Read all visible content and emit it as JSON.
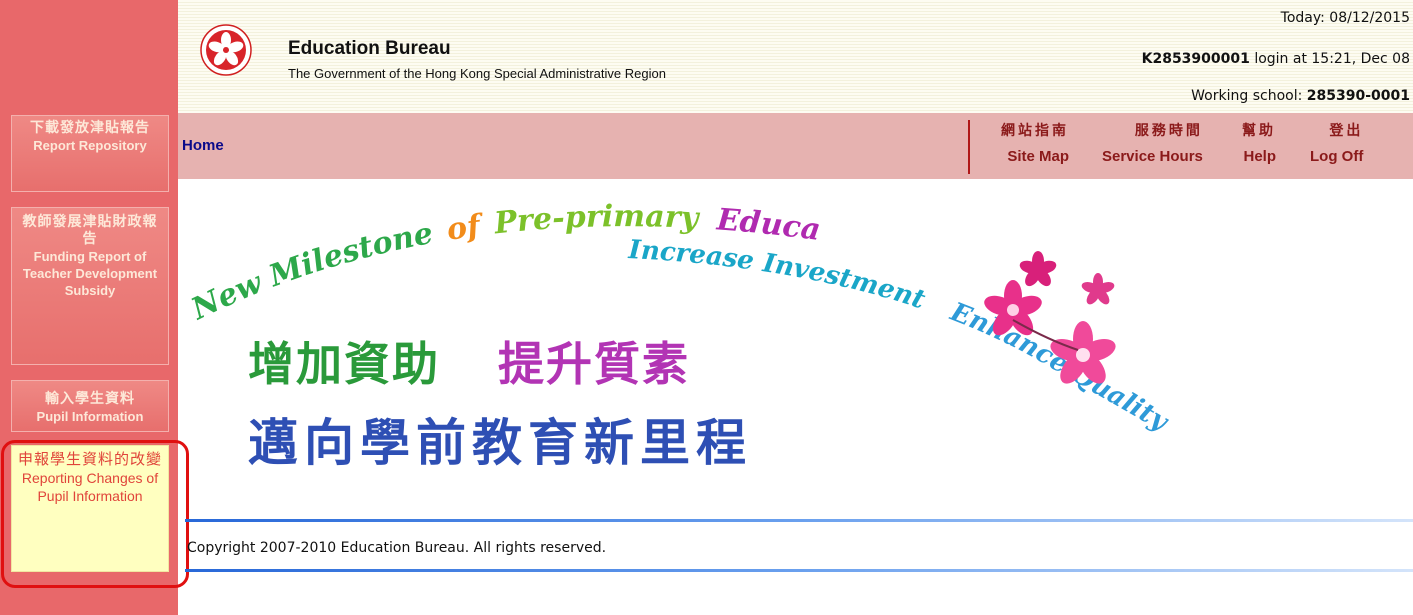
{
  "sidebar": {
    "items": [
      {
        "zh": "下載發放津貼報告",
        "en": "Report Repository"
      },
      {
        "zh": "教師發展津貼財政報告",
        "en": "Funding Report of Teacher Development Subsidy"
      },
      {
        "zh": "輸入學生資料",
        "en": "Pupil Information"
      },
      {
        "zh": "申報學生資料的改變",
        "en": "Reporting Changes of Pupil Information",
        "active": true
      }
    ]
  },
  "header": {
    "org_name": "Education Bureau",
    "org_sub": "The Government of the Hong Kong Special Administrative Region",
    "today_label": "Today: ",
    "today_value": "08/12/2015",
    "login_user": "K2853900001",
    "login_text": " login at 15:21, Dec 08",
    "school_label": "Working school: ",
    "school_value": "285390-0001"
  },
  "nav": {
    "home": "Home",
    "items": [
      {
        "zh": "網站指南",
        "en": "Site Map"
      },
      {
        "zh": "服務時間",
        "en": "Service Hours"
      },
      {
        "zh": "幫助",
        "en": "Help"
      },
      {
        "zh": "登出",
        "en": "Log Off"
      }
    ]
  },
  "banner": {
    "line_a1": "New Milestone",
    "line_a2": "of",
    "line_a3": "Pre-primary",
    "line_a4": "Education",
    "line_b": "Increase Investment",
    "line_c": "Enhance Quality",
    "zh_line1_part1": "增加資助",
    "zh_line1_part2": "提升質素",
    "zh_line2": "邁向學前教育新里程"
  },
  "footer": {
    "copyright": "Copyright 2007-2010 Education Bureau. All rights reserved."
  },
  "colors": {
    "sidebar_bg": "#e8686a",
    "nav_bg": "#e6b2b0",
    "nav_text": "#8b1a1a",
    "home_link": "#0a0a8a",
    "active_item_bg": "#ffffc0",
    "highlight_ring": "#e01010"
  }
}
